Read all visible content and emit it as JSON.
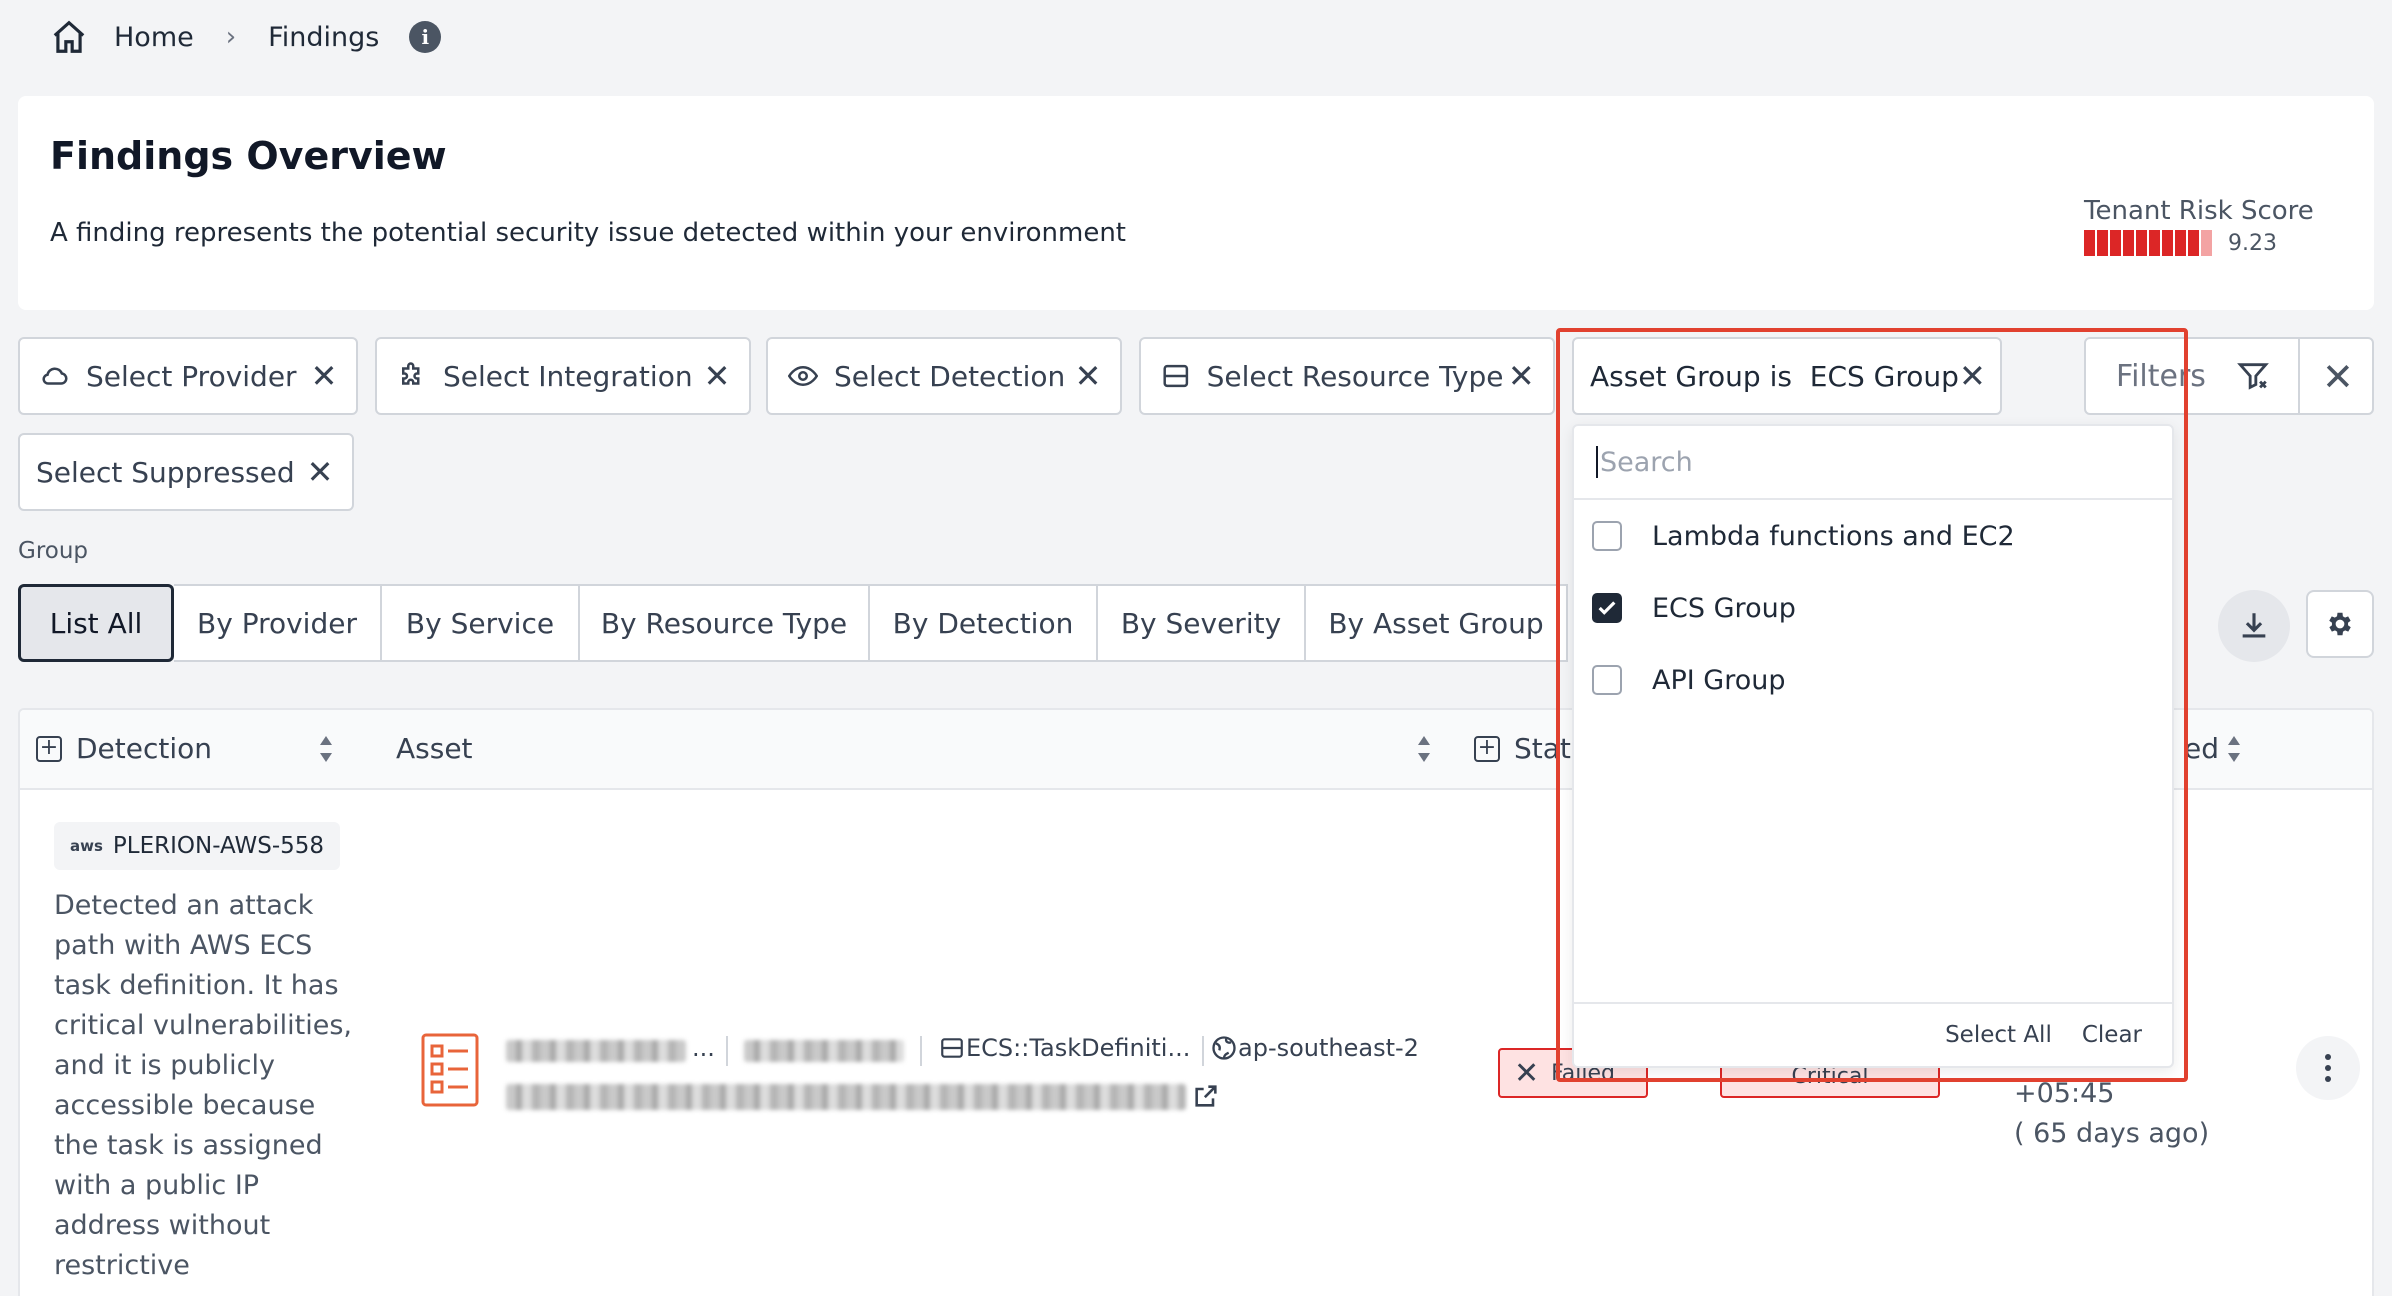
{
  "breadcrumb": {
    "home": "Home",
    "separator": "›",
    "current": "Findings",
    "info": "i"
  },
  "overview": {
    "title": "Findings Overview",
    "description": "A finding represents the potential security issue detected within your environment",
    "risk_label": "Tenant Risk Score",
    "risk_value": "9.23",
    "risk_score": 9.23,
    "risk_color": "#dc2626"
  },
  "filters": {
    "provider": "Select Provider",
    "integration": "Select Integration",
    "detection": "Select Detection",
    "resource_type": "Select Resource Type",
    "asset_group": "Asset Group is  ECS Group",
    "suppressed": "Select Suppressed",
    "filters_label": "Filters",
    "close_glyph": "✕"
  },
  "group": {
    "label": "Group",
    "tabs": [
      "List All",
      "By Provider",
      "By Service",
      "By Resource Type",
      "By Detection",
      "By Severity",
      "By Asset Group"
    ],
    "active": "List All"
  },
  "table": {
    "headers": {
      "detection": "Detection",
      "asset": "Asset",
      "status": "Statu",
      "last": "ed"
    },
    "row": {
      "detection_id": "PLERION-AWS-558",
      "provider_logo": "aws",
      "description": "Detected an attack path with AWS ECS task definition. It has critical vulnerabilities, and it is publicly accessible because the task is assigned with a public IP address without restrictive",
      "asset_ellipsis": "...",
      "resource_type": "ECS::TaskDefiniti...",
      "region": "ap-southeast-2",
      "status": "Failed",
      "severity": "Critical",
      "date_time": "+05:45",
      "date_ago": "( 65 days ago)"
    }
  },
  "dropdown": {
    "search_placeholder": "Search",
    "options": [
      {
        "label": "Lambda functions and EC2",
        "checked": false
      },
      {
        "label": "ECS Group",
        "checked": true
      },
      {
        "label": "API Group",
        "checked": false
      }
    ],
    "select_all": "Select All",
    "clear": "Clear"
  },
  "colors": {
    "highlight": "#e1412f",
    "danger": "#dc2626",
    "accent": "#1f2937"
  },
  "icons": [
    "home-icon",
    "chevron-right-icon",
    "info-icon",
    "cloud-icon",
    "puzzle-icon",
    "eye-icon",
    "server-icon",
    "close-icon",
    "filter-icon",
    "download-icon",
    "gear-icon",
    "sort-icon",
    "list-icon",
    "external-link-icon",
    "globe-icon",
    "kebab-icon",
    "check-icon"
  ]
}
